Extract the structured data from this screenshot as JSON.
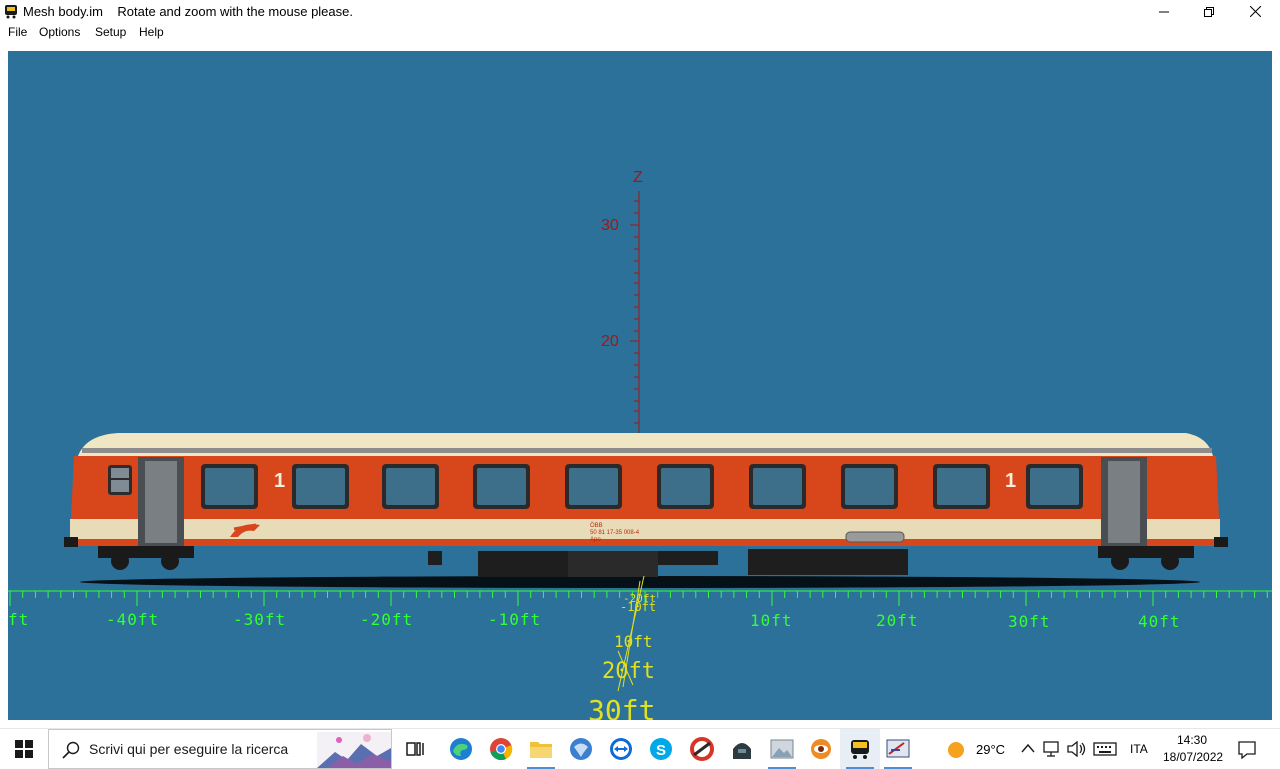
{
  "window": {
    "title": "Mesh body.im    Rotate and zoom with the mouse please."
  },
  "menu": [
    {
      "label": "File"
    },
    {
      "label": "Options"
    },
    {
      "label": "Setup"
    },
    {
      "label": "Help"
    }
  ],
  "viewport": {
    "background": "#2b7199",
    "z_axis": {
      "label": "Z",
      "color": "#a01818",
      "ticks": [
        "30",
        "20"
      ]
    },
    "x_axis": {
      "color": "#33ff33",
      "ticks": [
        "ft",
        "-40ft",
        "-30ft",
        "-20ft",
        "-10ft",
        "10ft",
        "20ft",
        "30ft",
        "40ft"
      ]
    },
    "y_axis": {
      "color": "#e0e020",
      "ticks": [
        "-20ft",
        "-10ft",
        "10ft",
        "20ft",
        "30ft"
      ]
    },
    "coach": {
      "class_number_left": "1",
      "class_number_right": "1",
      "operator": "ÖBB",
      "number": "50 81 17-35 008-4",
      "type": "Apo",
      "body_color": "#d8461c",
      "stripe_color": "#e8dcb8",
      "roof_color": "#efe6c4"
    }
  },
  "taskbar": {
    "search_placeholder": "Scrivi qui per eseguire la ricerca",
    "apps": [
      {
        "icon": "task-view-icon"
      },
      {
        "icon": "edge-icon"
      },
      {
        "icon": "chrome-icon"
      },
      {
        "icon": "file-explorer-icon"
      },
      {
        "icon": "app-icon-blue-globe"
      },
      {
        "icon": "teamviewer-icon"
      },
      {
        "icon": "skype-icon"
      },
      {
        "icon": "ccleaner-icon"
      },
      {
        "icon": "app-icon-dark-figure"
      },
      {
        "icon": "photos-icon"
      },
      {
        "icon": "eye-app-icon"
      },
      {
        "icon": "train-app-icon"
      },
      {
        "icon": "mesh-viewer-icon"
      }
    ],
    "weather": {
      "temp": "29°C"
    },
    "language": "ITA",
    "time": "14:30",
    "date": "18/07/2022"
  }
}
